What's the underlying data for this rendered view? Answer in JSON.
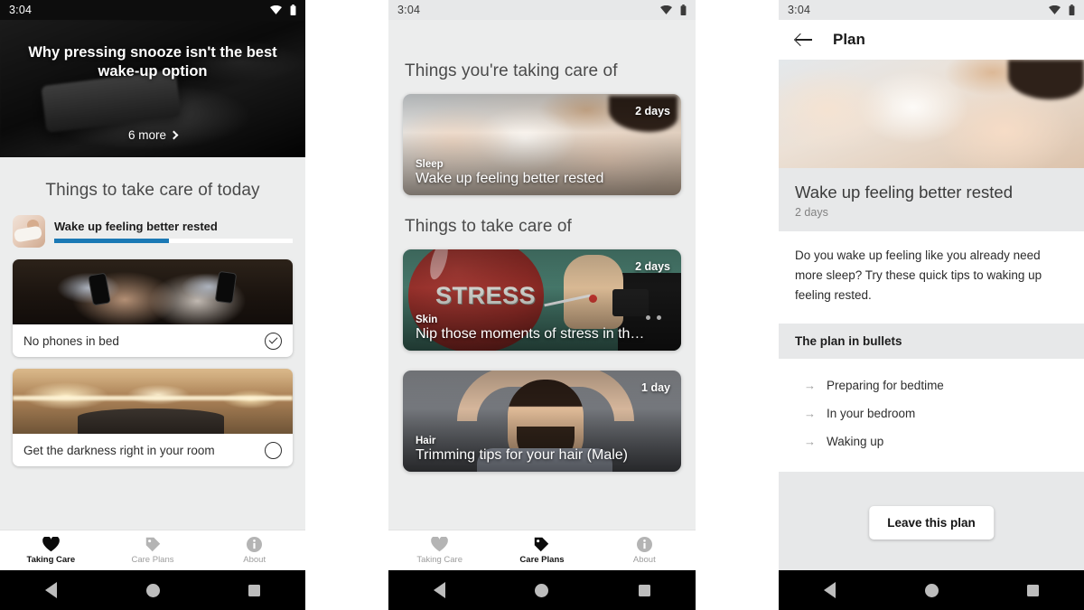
{
  "meta": {
    "app": "Taking Care",
    "screens": 3
  },
  "status_bar": {
    "time": "3:04",
    "icons": [
      "wifi-icon",
      "battery-icon"
    ]
  },
  "nav_bar": {
    "back": "back-triangle",
    "home": "home-circle",
    "recents": "recents-square"
  },
  "bottom_tabs": {
    "items": [
      {
        "label": "Taking Care",
        "icon": "heart-icon"
      },
      {
        "label": "Care Plans",
        "icon": "tags-icon"
      },
      {
        "label": "About",
        "icon": "info-icon"
      }
    ],
    "active_screen1": "Taking Care",
    "active_screen2": "Care Plans"
  },
  "screen1": {
    "hero": {
      "title": "Why pressing snooze isn't the best wake-up option",
      "more_label": "6 more",
      "more_icon": "chevron-right-icon"
    },
    "section_title": "Things to take care of today",
    "plan": {
      "name": "Wake up feeling better rested",
      "progress_percent": 48,
      "progress_color": "#1b79b5",
      "thumb": "sleeping-couple-thumb"
    },
    "tasks": [
      {
        "label": "No phones in bed",
        "state": "done",
        "check_icon": "check-circle-icon",
        "image": "couple-on-phones-in-bed"
      },
      {
        "label": "Get the darkness right in your room",
        "state": "todo",
        "check_icon": "empty-circle-icon",
        "image": "warm-lit-bedroom"
      }
    ]
  },
  "screen2": {
    "section_taking_care": "Things you're taking care of",
    "section_to_take_care": "Things to take care of",
    "taking_care_cards": [
      {
        "category": "Sleep",
        "title": "Wake up feeling better rested",
        "duration": "2 days",
        "image": "sleeping-couple",
        "has_dots": false
      }
    ],
    "to_take_care_cards": [
      {
        "category": "Skin",
        "title": "Nip those moments of stress in th…",
        "duration": "2 days",
        "image": "stress-balloon-pin",
        "image_word": "STRESS",
        "has_dots": true
      },
      {
        "category": "Hair",
        "title": "Trimming tips for your hair (Male)",
        "duration": "1 day",
        "image": "bearded-man-hands-on-head",
        "has_dots": false
      }
    ]
  },
  "screen3": {
    "appbar": {
      "title": "Plan",
      "back_icon": "arrow-back-icon"
    },
    "hero_image": "sleeping-couple",
    "plan_title": "Wake up feeling better rested",
    "plan_duration": "2 days",
    "description": "Do you wake up feeling like you already need more sleep? Try these quick tips to waking up feeling rested.",
    "bullets_heading": "The plan in bullets",
    "bullets": [
      {
        "arrow": "→",
        "text": "Preparing for bedtime"
      },
      {
        "arrow": "→",
        "text": "In your bedroom"
      },
      {
        "arrow": "→",
        "text": "Waking up"
      }
    ],
    "leave_button": "Leave this plan"
  }
}
